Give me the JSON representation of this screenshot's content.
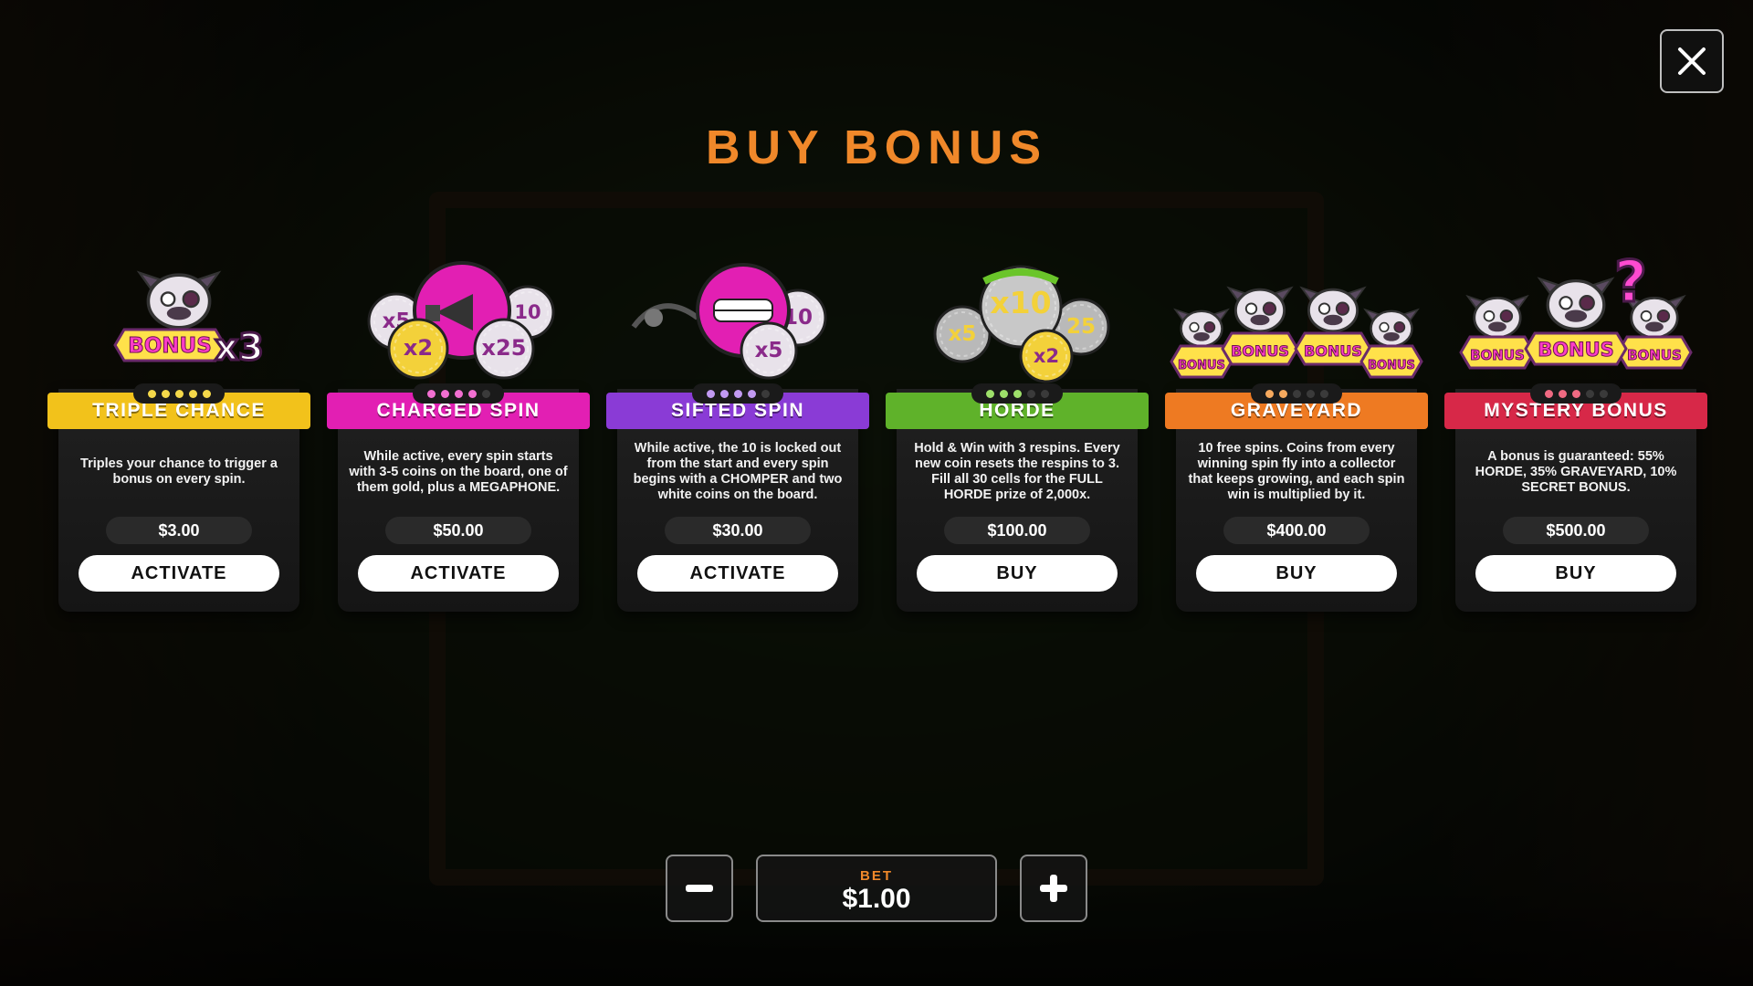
{
  "title": "BUY BONUS",
  "close_icon": "close-icon",
  "cards": [
    {
      "name": "TRIPLE CHANCE",
      "color": "#f2c21b",
      "dot_color": "#f5d94a",
      "level": 5,
      "level_max": 5,
      "description": "Triples your chance to trigger a bonus on every spin.",
      "price": "$3.00",
      "action": "ACTIVATE",
      "art": {
        "icon": "bonus-x3-icon",
        "label": "BONUS",
        "multiplier": "x3"
      }
    },
    {
      "name": "CHARGED SPIN",
      "color": "#e21fb3",
      "dot_color": "#f26fd1",
      "level": 4,
      "level_max": 5,
      "description": "While active, every spin starts with 3-5 coins on the board, one of them gold, plus a MEGAPHONE.",
      "price": "$50.00",
      "action": "ACTIVATE",
      "art": {
        "icon": "megaphone-coins-icon",
        "coins": [
          "x2",
          "x25",
          "x5",
          "10"
        ]
      }
    },
    {
      "name": "SIFTED SPIN",
      "color": "#8a3bd6",
      "dot_color": "#c29af2",
      "level": 4,
      "level_max": 5,
      "description": "While active, the 10 is locked out from the start and every spin begins with a CHOMPER and two white coins on the board.",
      "price": "$30.00",
      "action": "ACTIVATE",
      "art": {
        "icon": "chomper-coins-icon",
        "coins": [
          "x5",
          "10"
        ]
      }
    },
    {
      "name": "HORDE",
      "color": "#5fb22a",
      "dot_color": "#9ee06a",
      "level": 3,
      "level_max": 5,
      "description": "Hold & Win with 3 respins. Every new coin resets the respins to 3. Fill all 30 cells for the FULL HORDE prize of 2,000x.",
      "price": "$100.00",
      "action": "BUY",
      "art": {
        "icon": "horde-coins-icon",
        "coins": [
          "x5",
          "x10",
          "25",
          "x2"
        ]
      }
    },
    {
      "name": "GRAVEYARD",
      "color": "#ee7a22",
      "dot_color": "#f6a95e",
      "level": 2,
      "level_max": 5,
      "description": "10 free spins. Coins from every winning spin fly into a collector that keeps growing, and each spin win is multiplied by it.",
      "price": "$400.00",
      "action": "BUY",
      "art": {
        "icon": "graveyard-bonus-icon",
        "label": "BONUS"
      }
    },
    {
      "name": "MYSTERY BONUS",
      "color": "#d72848",
      "dot_color": "#f06a82",
      "level": 3,
      "level_max": 5,
      "description": "A bonus is guaranteed: 55% HORDE, 35% GRAVEYARD, 10% SECRET BONUS.",
      "price": "$500.00",
      "action": "BUY",
      "art": {
        "icon": "mystery-bonus-icon",
        "label": "BONUS",
        "mark": "?"
      }
    }
  ],
  "bet": {
    "label": "BET",
    "value": "$1.00",
    "minus_icon": "minus-icon",
    "plus_icon": "plus-icon"
  }
}
